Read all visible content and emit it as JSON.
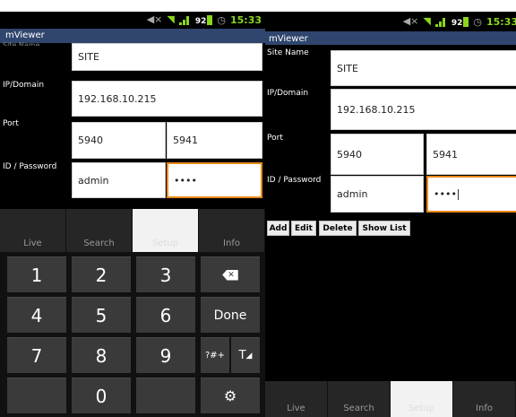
{
  "statusbar": {
    "battery": "92",
    "left_time": "15:33",
    "right_time": "15:33",
    "icons": [
      "mute-icon",
      "wifi-icon",
      "signal-icon",
      "battery-icon",
      "alarm-clock-icon"
    ]
  },
  "app": {
    "title": "mViewer"
  },
  "form": {
    "site_label": "Site Name",
    "site_value": "SITE",
    "ip_label": "IP/Domain",
    "ip_value": "192.168.10.215",
    "port_label": "Port",
    "port1_value": "5940",
    "port2_value": "5941",
    "idpw_label": "ID / Password",
    "id_value": "admin",
    "password_value": "••••"
  },
  "actions": {
    "add": "Add",
    "edit": "Edit",
    "delete": "Delete",
    "show_list": "Show List"
  },
  "tabs": [
    {
      "label": "Live"
    },
    {
      "label": "Search"
    },
    {
      "label": "Setup",
      "active": true
    },
    {
      "label": "Info"
    }
  ],
  "keypad": {
    "row1": [
      "1",
      "2",
      "3"
    ],
    "row2": [
      "4",
      "5",
      "6"
    ],
    "row3": [
      "7",
      "8",
      "9"
    ],
    "zero": "0",
    "done": "Done",
    "symbols": "?#+",
    "text_mode": "T"
  },
  "colors": {
    "accent": "#30466e",
    "focus": "#e98a1a",
    "status_green": "#8bd61e"
  }
}
